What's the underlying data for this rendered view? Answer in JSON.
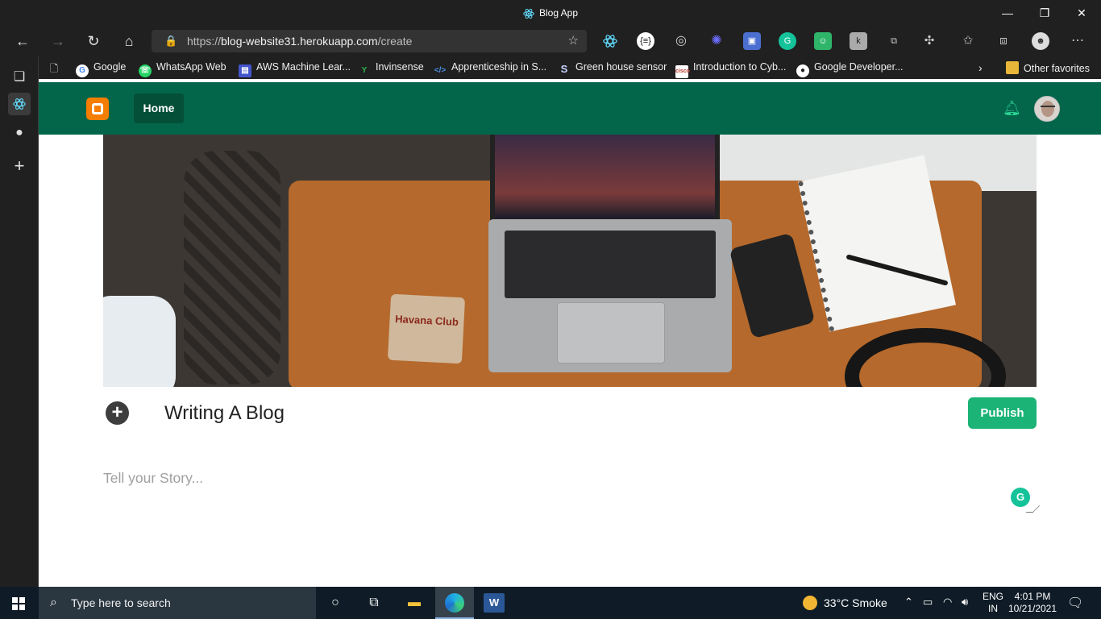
{
  "window": {
    "title": "Blog App"
  },
  "browser": {
    "url_scheme": "https://",
    "url_host": "blog-website31.herokuapp.com",
    "url_path": "/create"
  },
  "favorites": [
    {
      "label": "Google",
      "icon": "google-icon",
      "color": "#ffffff"
    },
    {
      "label": "WhatsApp Web",
      "icon": "whatsapp-icon",
      "color": "#25d366"
    },
    {
      "label": "AWS Machine Lear...",
      "icon": "aws-icon",
      "color": "#4455cc"
    },
    {
      "label": "Invinsense",
      "icon": "invinsense-icon",
      "color": "#2db34a"
    },
    {
      "label": "Apprenticeship in S...",
      "icon": "code-icon",
      "color": "#4a90e2"
    },
    {
      "label": "Green house sensor",
      "icon": "s-icon",
      "color": "#202020"
    },
    {
      "label": "Introduction to Cyb...",
      "icon": "cisco-icon",
      "color": "#c0392b"
    },
    {
      "label": "Google Developer...",
      "icon": "github-icon",
      "color": "#202020"
    }
  ],
  "other_favorites": "Other favorites",
  "app": {
    "home_label": "Home",
    "blog_title": "Writing A Blog",
    "publish_label": "Publish",
    "story_placeholder": "Tell your Story...",
    "coaster_text": "Havana Club",
    "accent": "#03664a",
    "publish_color": "#1bb376"
  },
  "taskbar": {
    "search_placeholder": "Type here to search",
    "weather": "33°C  Smoke",
    "lang_line1": "ENG",
    "lang_line2": "IN",
    "time": "4:01 PM",
    "date": "10/21/2021"
  }
}
